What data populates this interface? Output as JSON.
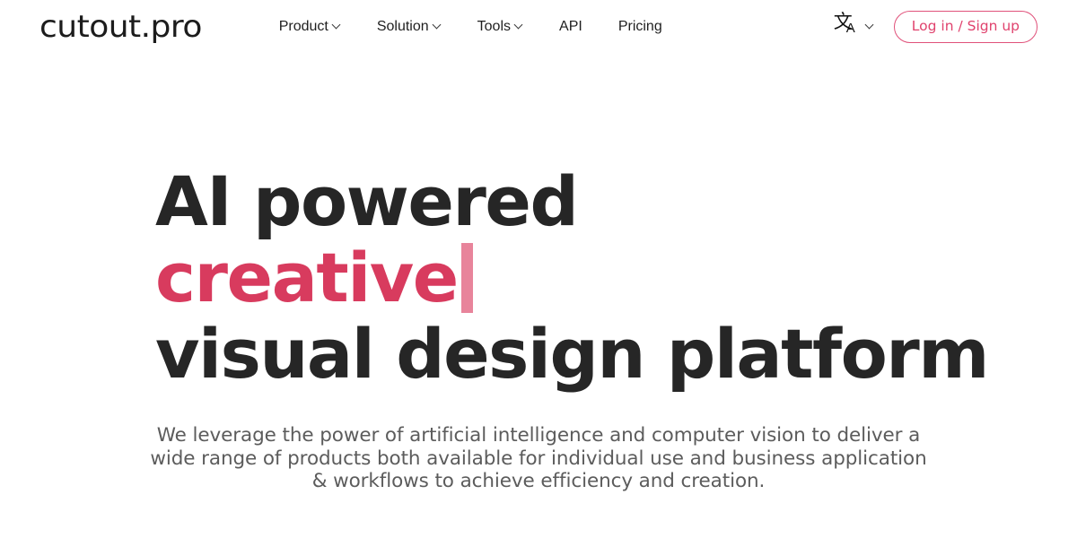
{
  "header": {
    "logo_text": "cutout.pro",
    "nav": [
      {
        "label": "Product",
        "has_dropdown": true,
        "icon": "chevron-down-icon"
      },
      {
        "label": "Solution",
        "has_dropdown": true,
        "icon": "chevron-down-icon"
      },
      {
        "label": "Tools",
        "has_dropdown": true,
        "icon": "chevron-down-icon"
      },
      {
        "label": "API",
        "has_dropdown": false,
        "icon": ""
      },
      {
        "label": "Pricing",
        "has_dropdown": false,
        "icon": ""
      }
    ],
    "language": {
      "icon": "translate-icon",
      "glyph_cjk": "文",
      "glyph_latin": "A",
      "chevron": "chevron-down-icon"
    },
    "auth_button_label": "Log in / Sign up"
  },
  "hero": {
    "headline_line1": "AI powered",
    "headline_line2": "creative",
    "headline_line3": "visual design platform",
    "typing_caret": true,
    "subtitle_line1": "We leverage the power of artificial intelligence and computer vision to deliver a",
    "subtitle_line2": "wide range of products both available for individual use and business application",
    "subtitle_line3": "& workflows to achieve efficiency and creation."
  },
  "colors": {
    "accent": "#d83b5e",
    "accent_light": "#e8849b",
    "button_border": "#e0517a",
    "button_text": "#e0426d",
    "heading": "#262626",
    "body_text": "#5c5c5c",
    "background": "#ffffff"
  }
}
